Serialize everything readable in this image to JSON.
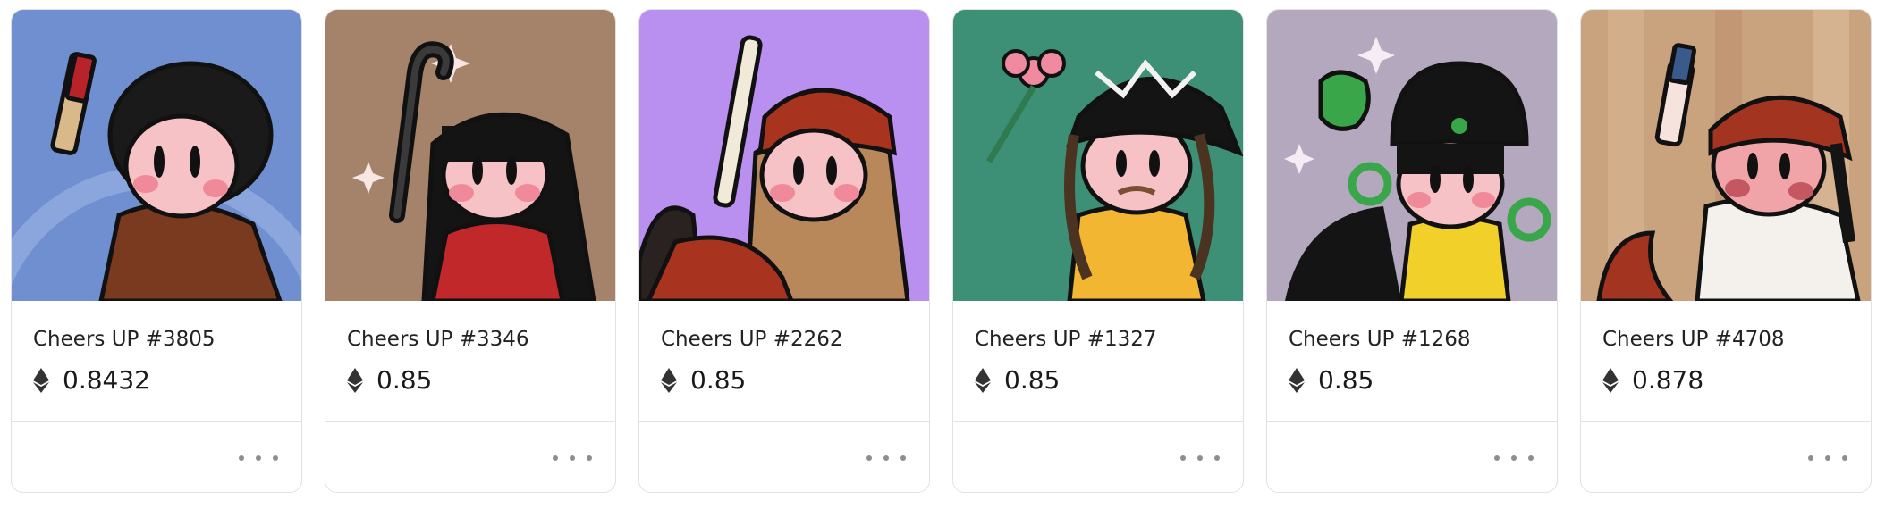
{
  "cards": [
    {
      "title": "Cheers UP #3805",
      "price": "0.8432",
      "bg": "#6f8fd0",
      "hair": "#1a1a1a",
      "accent": "#7a3a20"
    },
    {
      "title": "Cheers UP #3346",
      "price": "0.85",
      "bg": "#a4836a",
      "hair": "#141414",
      "accent": "#c0282a"
    },
    {
      "title": "Cheers UP #2262",
      "price": "0.85",
      "bg": "#b98ff0",
      "hair": "#b8875a",
      "accent": "#a8341f"
    },
    {
      "title": "Cheers UP #1327",
      "price": "0.85",
      "bg": "#3d9076",
      "hair": "#4a3320",
      "accent": "#f2b632"
    },
    {
      "title": "Cheers UP #1268",
      "price": "0.85",
      "bg": "#b4a8bf",
      "hair": "#141414",
      "accent": "#3aa64a"
    },
    {
      "title": "Cheers UP #4708",
      "price": "0.878",
      "bg": "#c9a27e",
      "hair": "#141414",
      "accent": "#a33420"
    }
  ],
  "icons": {
    "currency": "ethereum-icon",
    "menu": "more-options-icon"
  }
}
